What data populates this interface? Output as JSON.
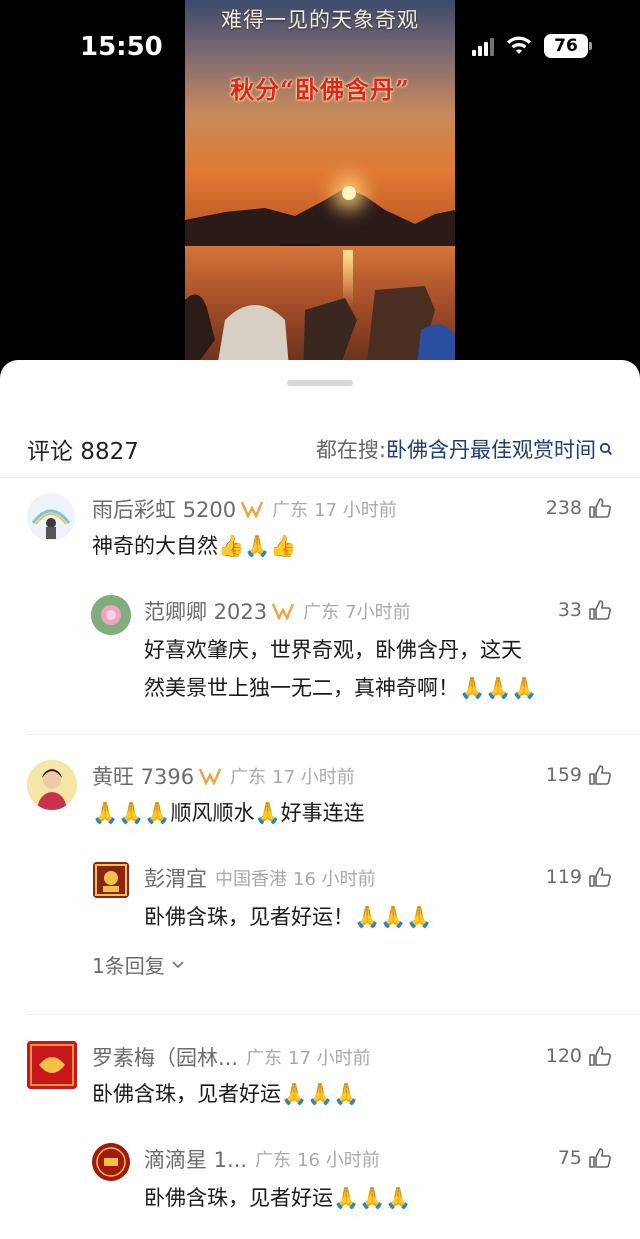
{
  "status_bar": {
    "time": "15:50",
    "battery": "76"
  },
  "video": {
    "caption": "难得一见的天象奇观",
    "headline": "秋分“卧佛含丹”"
  },
  "header": {
    "comment_count": "评论 8827",
    "hot_label": "都在搜:",
    "hot_term": "卧佛含丹最佳观赏时间"
  },
  "comments": [
    {
      "user": "雨后彩虹 5200",
      "location": "广东",
      "time": "17 小时前",
      "likes": "238",
      "text": "神奇的大自然👍🙏👍",
      "reply": {
        "user": "范卿卿 2023",
        "location": "广东",
        "time": "7小时前",
        "likes": "33",
        "text_line1": "好喜欢肇庆，世界奇观，卧佛含丹，这天",
        "text_line2": "然美景世上独一无二，真神奇啊！🙏🙏🙏"
      }
    },
    {
      "user": "黄旺 7396",
      "location": "广东",
      "time": "17 小时前",
      "likes": "159",
      "text": "🙏🙏🙏顺风顺水🙏好事连连",
      "reply": {
        "user": "彭渭宜",
        "location": "中国香港",
        "time": "16 小时前",
        "likes": "119",
        "text": "卧佛含珠，见者好运！🙏🙏🙏"
      },
      "more_replies": "1条回复"
    },
    {
      "user": "罗素梅（园林...",
      "location": "广东",
      "time": "17 小时前",
      "likes": "120",
      "text": "卧佛含珠，见者好运🙏🙏🙏",
      "reply": {
        "user": "滴滴星 1...",
        "location": "广东",
        "time": "16 小时前",
        "likes": "75",
        "text": "卧佛含珠，见者好运🙏🙏🙏"
      }
    }
  ],
  "colors": {
    "accent_link": "#1f3d7a",
    "badge_orange": "#f0a23c",
    "sheet_bg": "#ffffff"
  },
  "icons": [
    "signal-icon",
    "wifi-icon",
    "battery-icon",
    "search-icon",
    "thumbs-up-icon",
    "verified-badge-icon",
    "chevron-down-icon"
  ]
}
